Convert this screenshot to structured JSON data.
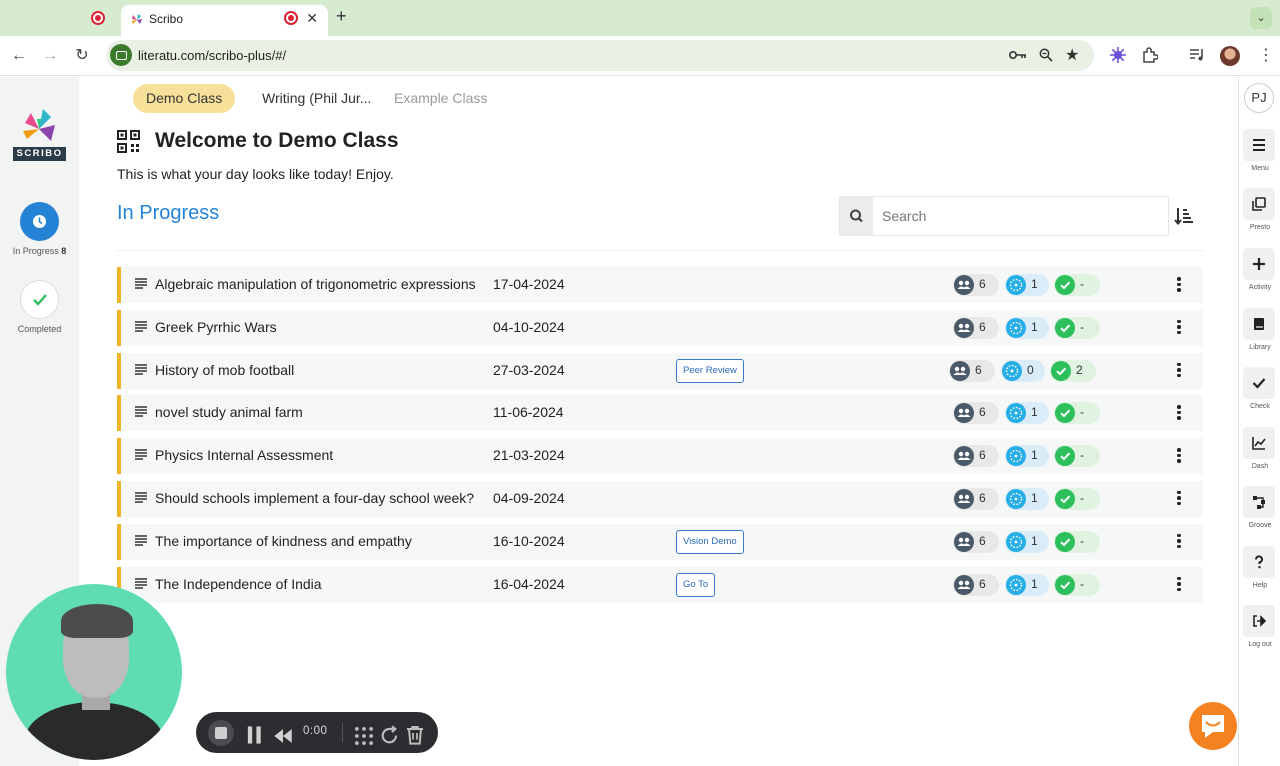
{
  "browser": {
    "active_tab_title": "Scribo",
    "new_tab_symbol": "+",
    "url": "literatu.com/scribo-plus/#/"
  },
  "logo": {
    "wordmark": "SCRIBO"
  },
  "left_nav": [
    {
      "label": "In Progress",
      "count": "8"
    },
    {
      "label": "Completed"
    }
  ],
  "class_tabs": [
    {
      "label": "Demo Class",
      "state": "active"
    },
    {
      "label": "Writing (Phil Jur...",
      "state": "normal"
    },
    {
      "label": "Example Class",
      "state": "muted"
    }
  ],
  "header": {
    "title": "Welcome to Demo Class",
    "subtitle": "This is what your day looks like today! Enjoy."
  },
  "section": {
    "title": "In Progress"
  },
  "search": {
    "placeholder": "Search",
    "value": ""
  },
  "activities": [
    {
      "title": "Algebraic manipulation of trigonometric expressions",
      "date": "17-04-2024",
      "tag": "",
      "students": "6",
      "in_progress": "1",
      "submitted": "-"
    },
    {
      "title": "Greek Pyrrhic Wars",
      "date": "04-10-2024",
      "tag": "",
      "students": "6",
      "in_progress": "1",
      "submitted": "-"
    },
    {
      "title": "History of mob football",
      "date": "27-03-2024",
      "tag": "Peer Review",
      "students": "6",
      "in_progress": "0",
      "submitted": "2"
    },
    {
      "title": "novel study animal farm",
      "date": "11-06-2024",
      "tag": "",
      "students": "6",
      "in_progress": "1",
      "submitted": "-"
    },
    {
      "title": "Physics Internal Assessment",
      "date": "21-03-2024",
      "tag": "",
      "students": "6",
      "in_progress": "1",
      "submitted": "-"
    },
    {
      "title": "Should schools implement a four-day school week?",
      "date": "04-09-2024",
      "tag": "",
      "students": "6",
      "in_progress": "1",
      "submitted": "-"
    },
    {
      "title": "The importance of kindness and empathy",
      "date": "16-10-2024",
      "tag": "Vision Demo",
      "students": "6",
      "in_progress": "1",
      "submitted": "-"
    },
    {
      "title": "The Independence of India",
      "date": "16-04-2024",
      "tag": "Go To",
      "students": "6",
      "in_progress": "1",
      "submitted": "-"
    }
  ],
  "right_nav": {
    "avatar_initials": "PJ",
    "items": [
      {
        "label": "Menu",
        "icon": "menu-icon"
      },
      {
        "label": "Presto",
        "icon": "copy-icon"
      },
      {
        "label": "Activity",
        "icon": "plus-icon"
      },
      {
        "label": "Library",
        "icon": "book-icon"
      },
      {
        "label": "Check",
        "icon": "check-icon"
      },
      {
        "label": "Dash",
        "icon": "chart-icon"
      },
      {
        "label": "Groove",
        "icon": "flow-icon"
      },
      {
        "label": "Help",
        "icon": "question-icon"
      },
      {
        "label": "Log out",
        "icon": "logout-icon"
      }
    ]
  },
  "recorder": {
    "time": "0:00"
  },
  "colors": {
    "accent_blue": "#2483d5",
    "row_accent": "#f0b429",
    "active_tab": "#f7e19a",
    "chat_orange": "#f58220"
  }
}
